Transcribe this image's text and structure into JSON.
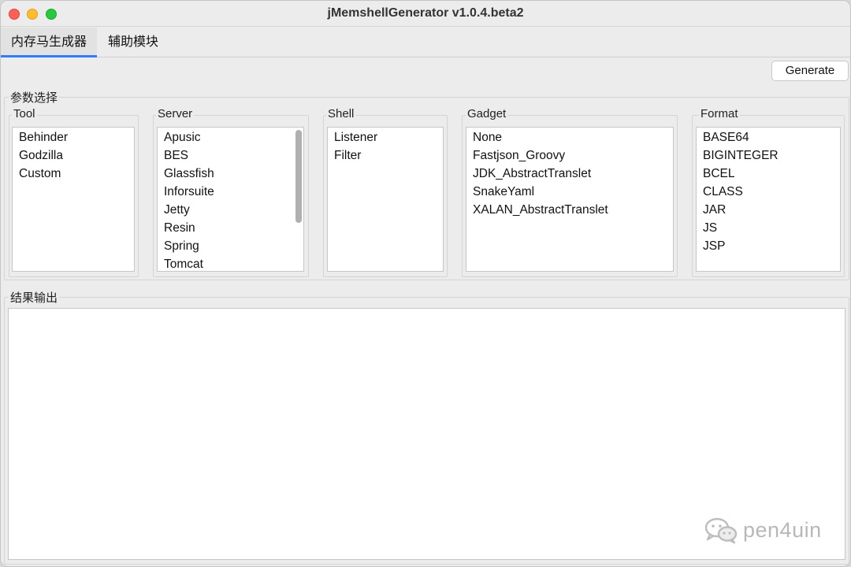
{
  "window": {
    "title": "jMemshellGenerator v1.0.4.beta2"
  },
  "tabs": [
    {
      "label": "内存马生成器",
      "active": true
    },
    {
      "label": "辅助模块",
      "active": false
    }
  ],
  "toolbar": {
    "generate_label": "Generate"
  },
  "params": {
    "label": "参数选择",
    "tool": {
      "label": "Tool",
      "items": [
        "Behinder",
        "Godzilla",
        "Custom"
      ]
    },
    "server": {
      "label": "Server",
      "items": [
        "Apusic",
        "BES",
        "Glassfish",
        "Inforsuite",
        "Jetty",
        "Resin",
        "Spring",
        "Tomcat"
      ]
    },
    "shell": {
      "label": "Shell",
      "items": [
        "Listener",
        "Filter"
      ]
    },
    "gadget": {
      "label": "Gadget",
      "items": [
        "None",
        "Fastjson_Groovy",
        "JDK_AbstractTranslet",
        "SnakeYaml",
        "XALAN_AbstractTranslet"
      ]
    },
    "format": {
      "label": "Format",
      "items": [
        "BASE64",
        "BIGINTEGER",
        "BCEL",
        "CLASS",
        "JAR",
        "JS",
        "JSP"
      ]
    }
  },
  "output": {
    "label": "结果输出",
    "value": ""
  },
  "watermark": {
    "text": "pen4uin",
    "icon": "wechat-icon"
  },
  "colors": {
    "accent": "#2f7cf6",
    "close": "#fe5f57",
    "minimize": "#febc2e",
    "maximize": "#28c840"
  }
}
